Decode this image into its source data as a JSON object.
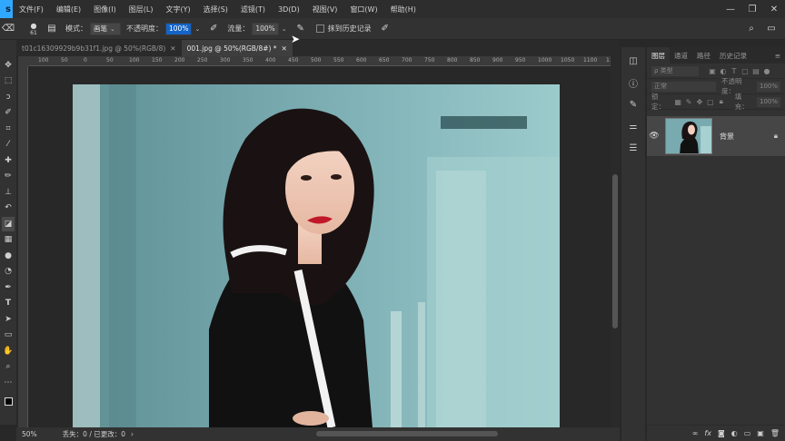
{
  "app": {
    "logo_text": "s",
    "menu": [
      "文件(F)",
      "编辑(E)",
      "图像(I)",
      "图层(L)",
      "文字(Y)",
      "选择(S)",
      "滤镜(T)",
      "3D(D)",
      "视图(V)",
      "窗口(W)",
      "帮助(H)"
    ],
    "window_controls": [
      "—",
      "❐",
      "✕"
    ]
  },
  "options": {
    "brush_size": "61",
    "mode_label": "模式：",
    "mode_value": "画笔",
    "opacity_label": "不透明度：",
    "opacity_value": "100%",
    "flow_label": "流量：",
    "flow_value": "100%",
    "history_label": "抹到历史记录"
  },
  "tabs": [
    {
      "title": "t01c16309929b9b31f1.jpg @ 50%(RGB/8)",
      "close": "✕",
      "active": false
    },
    {
      "title": "001.jpg @ 50%(RGB/8#) *",
      "close": "✕",
      "active": true
    }
  ],
  "ruler": {
    "ticks": [
      "100",
      "50",
      "0",
      "50",
      "100",
      "150",
      "200",
      "250",
      "300",
      "350",
      "400",
      "450",
      "500",
      "550",
      "600",
      "650",
      "700",
      "750",
      "800",
      "850",
      "900",
      "950",
      "1000",
      "1050",
      "1100",
      "1150"
    ]
  },
  "status": {
    "zoom": "50%",
    "info": "丢失：0 / 已更改：0"
  },
  "panel": {
    "tabs": [
      "图层",
      "通道",
      "路径",
      "历史记录"
    ],
    "kind_label": "ρ 类型",
    "blend_mode": "正常",
    "opacity_label": "不透明度：",
    "opacity_value": "100%",
    "lock_label": "锁定：",
    "fill_label": "填充：",
    "fill_value": "100%",
    "layer_name": "背景"
  },
  "colors": {
    "accent": "#31a8ff",
    "highlight": "#1464c8",
    "lips": "#c0182a"
  }
}
